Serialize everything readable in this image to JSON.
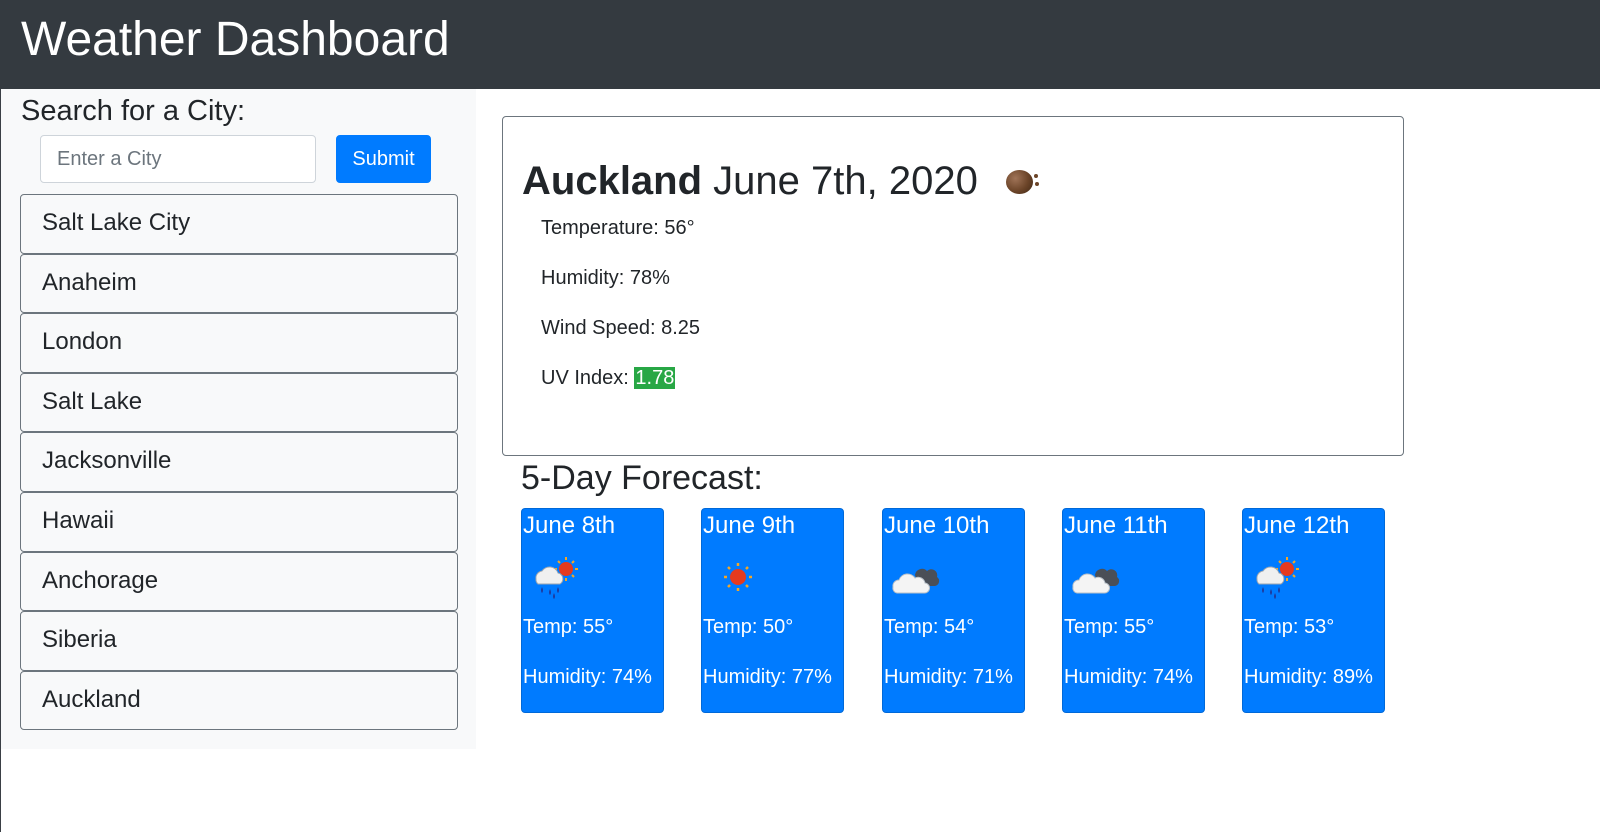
{
  "header": {
    "title": "Weather Dashboard"
  },
  "search": {
    "title": "Search for a City:",
    "placeholder": "Enter a City",
    "value": "",
    "submit_label": "Submit"
  },
  "cities": [
    {
      "label": "Salt Lake City"
    },
    {
      "label": "Anaheim"
    },
    {
      "label": "London"
    },
    {
      "label": "Salt Lake"
    },
    {
      "label": "Jacksonville"
    },
    {
      "label": "Hawaii"
    },
    {
      "label": "Anchorage"
    },
    {
      "label": "Siberia"
    },
    {
      "label": "Auckland"
    }
  ],
  "current": {
    "city": "Auckland",
    "date": "June 7th, 2020",
    "icon": "brown-ball-icon",
    "temperature": "Temperature: 56°",
    "humidity": "Humidity: 78%",
    "wind": "Wind Speed: 8.25",
    "uv_label": "UV Index: ",
    "uv_value": "1.78",
    "uv_color": "#28a745"
  },
  "forecast": {
    "title": "5-Day Forecast:",
    "card_color": "#007bff",
    "days": [
      {
        "date": "June 8th",
        "icon": "rain-sun-icon",
        "temp": "Temp: 55°",
        "humidity": "Humidity: 74%"
      },
      {
        "date": "June 9th",
        "icon": "sun-icon",
        "temp": "Temp: 50°",
        "humidity": "Humidity: 77%"
      },
      {
        "date": "June 10th",
        "icon": "clouds-icon",
        "temp": "Temp: 54°",
        "humidity": "Humidity: 71%"
      },
      {
        "date": "June 11th",
        "icon": "clouds-icon",
        "temp": "Temp: 55°",
        "humidity": "Humidity: 74%"
      },
      {
        "date": "June 12th",
        "icon": "rain-sun-icon",
        "temp": "Temp: 53°",
        "humidity": "Humidity: 89%"
      }
    ]
  }
}
